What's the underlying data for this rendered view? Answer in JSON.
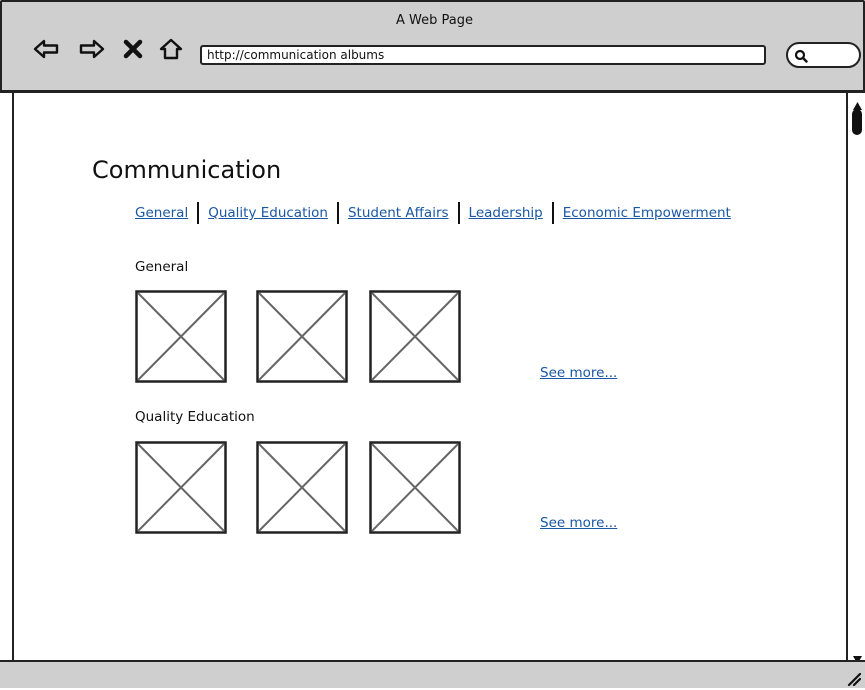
{
  "window": {
    "title": "A Web Page"
  },
  "browser": {
    "url": "http://communication albums",
    "nav_icons": [
      "back-arrow-icon",
      "forward-arrow-icon",
      "close-x-icon",
      "home-icon"
    ],
    "search_icon": "search-icon"
  },
  "page": {
    "title": "Communication",
    "tabs": [
      "General",
      "Quality Education",
      "Student Affairs",
      "Leadership",
      "Economic Empowerment"
    ],
    "sections": [
      {
        "label": "General",
        "see_more": "See more..."
      },
      {
        "label": "Quality Education",
        "see_more": "See more..."
      }
    ]
  },
  "colors": {
    "chrome": "#cfcfcf",
    "link": "#1a57a5",
    "border": "#222222"
  }
}
